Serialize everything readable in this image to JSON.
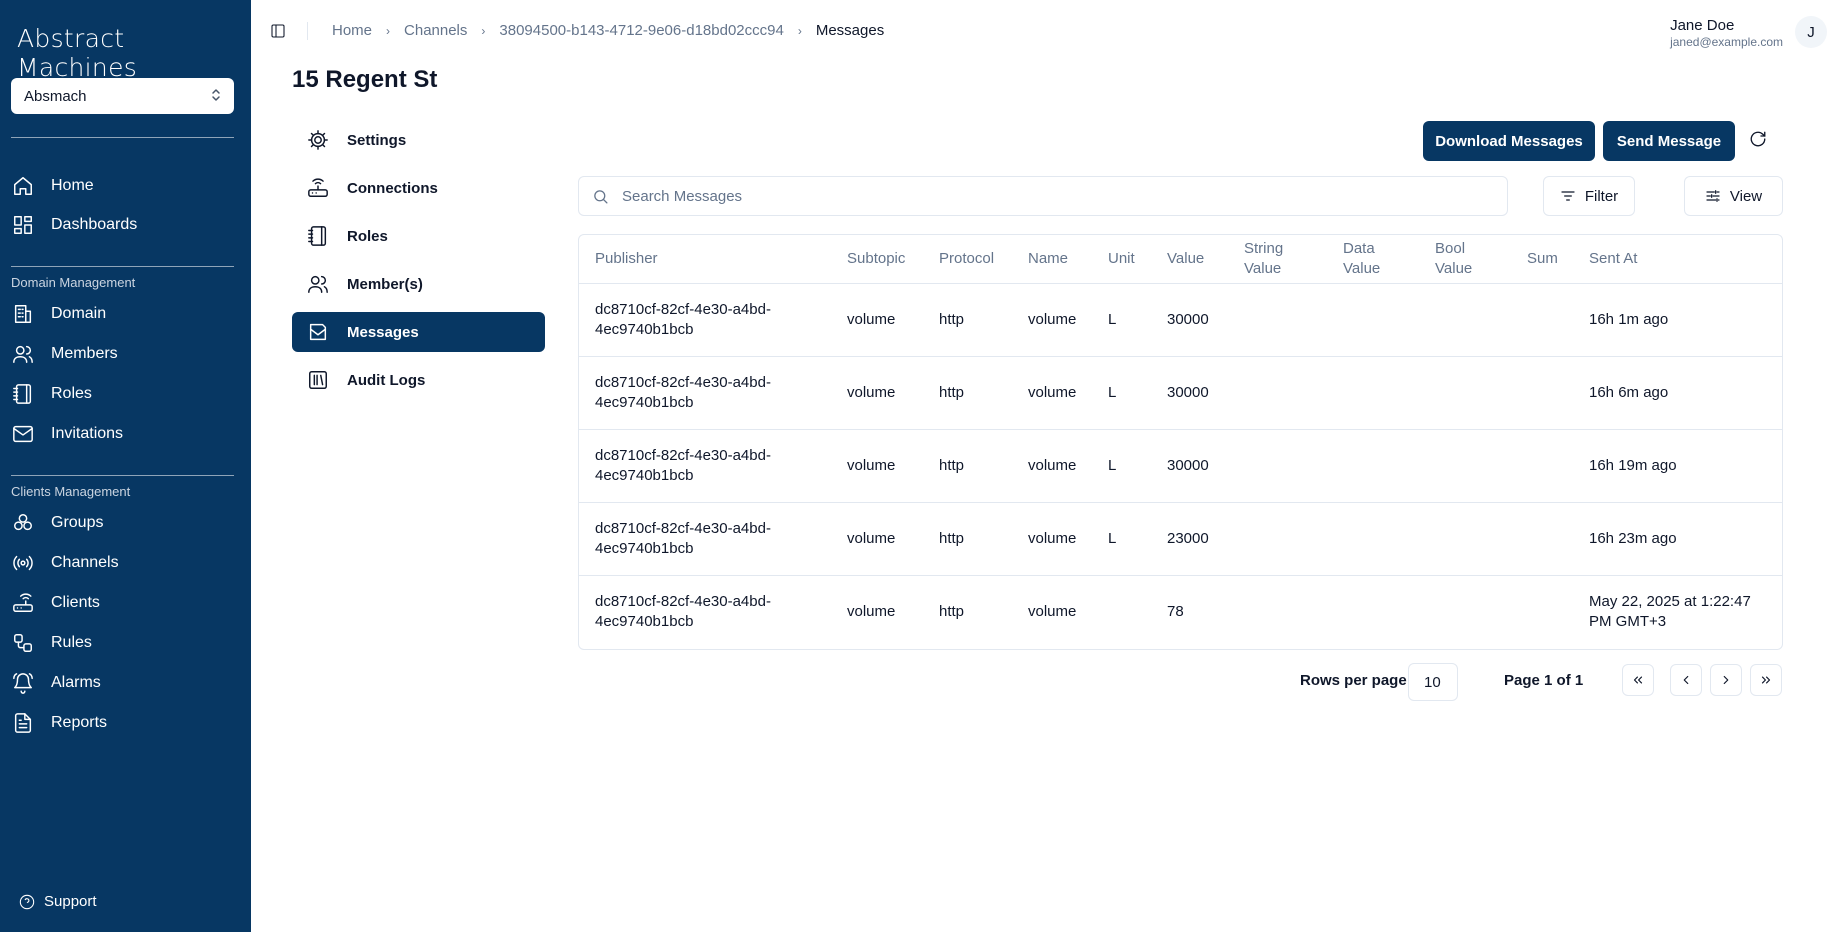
{
  "sidebar": {
    "logo": "Abstract Machines",
    "domain_select": "Absmach",
    "main_items": [
      {
        "label": "Home",
        "icon": "home-icon"
      },
      {
        "label": "Dashboards",
        "icon": "dashboard-icon"
      }
    ],
    "domain_group_label": "Domain Management",
    "domain_items": [
      {
        "label": "Domain",
        "icon": "building-icon"
      },
      {
        "label": "Members",
        "icon": "users-icon"
      },
      {
        "label": "Roles",
        "icon": "notebook-icon"
      },
      {
        "label": "Invitations",
        "icon": "mail-icon"
      }
    ],
    "clients_group_label": "Clients Management",
    "clients_items": [
      {
        "label": "Groups",
        "icon": "groups-icon"
      },
      {
        "label": "Channels",
        "icon": "radio-icon"
      },
      {
        "label": "Clients",
        "icon": "router-icon"
      },
      {
        "label": "Rules",
        "icon": "workflow-icon"
      },
      {
        "label": "Alarms",
        "icon": "bell-icon"
      },
      {
        "label": "Reports",
        "icon": "file-text-icon"
      }
    ],
    "support": "Support"
  },
  "header": {
    "breadcrumb": [
      "Home",
      "Channels",
      "38094500-b143-4712-9e06-d18bd02ccc94",
      "Messages"
    ],
    "user_name": "Jane Doe",
    "user_email": "janed@example.com",
    "avatar_initial": "J"
  },
  "page_title": "15 Regent St",
  "subnav": [
    {
      "label": "Settings",
      "icon": "settings-icon"
    },
    {
      "label": "Connections",
      "icon": "router-icon"
    },
    {
      "label": "Roles",
      "icon": "notebook-icon"
    },
    {
      "label": "Member(s)",
      "icon": "users-icon"
    },
    {
      "label": "Messages",
      "icon": "inbox-icon",
      "active": true
    },
    {
      "label": "Audit Logs",
      "icon": "library-icon"
    }
  ],
  "toolbar": {
    "download_label": "Download Messages",
    "send_label": "Send Message",
    "search_placeholder": "Search Messages",
    "filter_label": "Filter",
    "view_label": "View"
  },
  "table": {
    "columns": [
      "Publisher",
      "Subtopic",
      "Protocol",
      "Name",
      "Unit",
      "Value",
      "String Value",
      "Data Value",
      "Bool Value",
      "Sum",
      "Sent At"
    ],
    "rows": [
      [
        "dc8710cf-82cf-4e30-a4bd-4ec9740b1bcb",
        "volume",
        "http",
        "volume",
        "L",
        "30000",
        "",
        "",
        "",
        "",
        "16h 1m ago"
      ],
      [
        "dc8710cf-82cf-4e30-a4bd-4ec9740b1bcb",
        "volume",
        "http",
        "volume",
        "L",
        "30000",
        "",
        "",
        "",
        "",
        "16h 6m ago"
      ],
      [
        "dc8710cf-82cf-4e30-a4bd-4ec9740b1bcb",
        "volume",
        "http",
        "volume",
        "L",
        "30000",
        "",
        "",
        "",
        "",
        "16h 19m ago"
      ],
      [
        "dc8710cf-82cf-4e30-a4bd-4ec9740b1bcb",
        "volume",
        "http",
        "volume",
        "L",
        "23000",
        "",
        "",
        "",
        "",
        "16h 23m ago"
      ],
      [
        "dc8710cf-82cf-4e30-a4bd-4ec9740b1bcb",
        "volume",
        "http",
        "volume",
        "",
        "78",
        "",
        "",
        "",
        "",
        "May 22, 2025 at 1:22:47 PM GMT+3"
      ]
    ]
  },
  "pagination": {
    "rows_per_page_label": "Rows per page",
    "rows_per_page": "10",
    "page_info": "Page 1 of 1"
  },
  "colors": {
    "brand": "#073763",
    "border": "#e2e8f0",
    "muted_text": "#64748b"
  }
}
